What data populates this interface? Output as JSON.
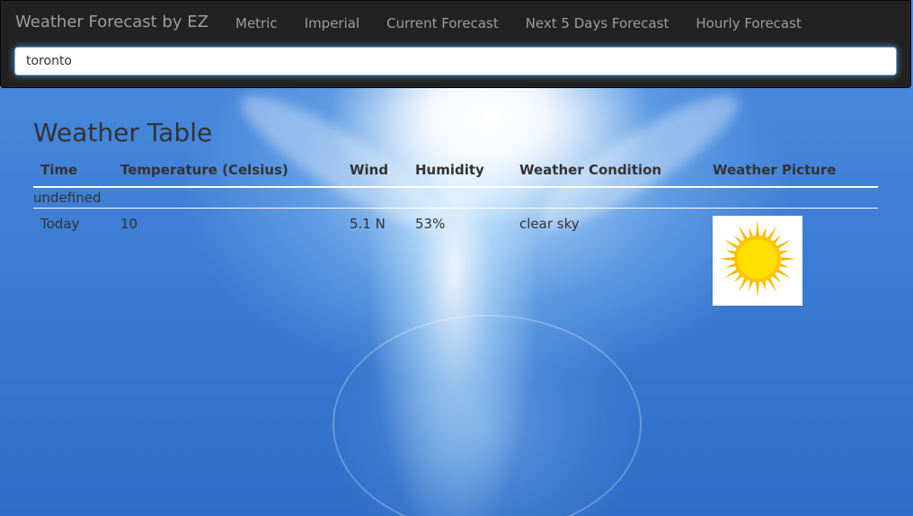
{
  "navbar": {
    "brand": "Weather Forecast by EZ",
    "links": [
      "Metric",
      "Imperial",
      "Current Forecast",
      "Next 5 Days Forecast",
      "Hourly Forecast"
    ]
  },
  "search": {
    "value": "toronto"
  },
  "main": {
    "title": "Weather Table",
    "table": {
      "headers": [
        "Time",
        "Temperature (Celsius)",
        "Wind",
        "Humidity",
        "Weather Condition",
        "Weather Picture"
      ],
      "caption_row": "undefined",
      "rows": [
        {
          "time": "Today",
          "temperature": "10",
          "wind": "5.1 N",
          "humidity": "53%",
          "condition": "clear sky",
          "picture_icon": "sun-icon"
        }
      ]
    }
  },
  "colors": {
    "navbar_bg": "#222222",
    "nav_text": "#9d9d9d",
    "sun_yellow": "#ffd700",
    "sun_rays": "#ffb800"
  }
}
